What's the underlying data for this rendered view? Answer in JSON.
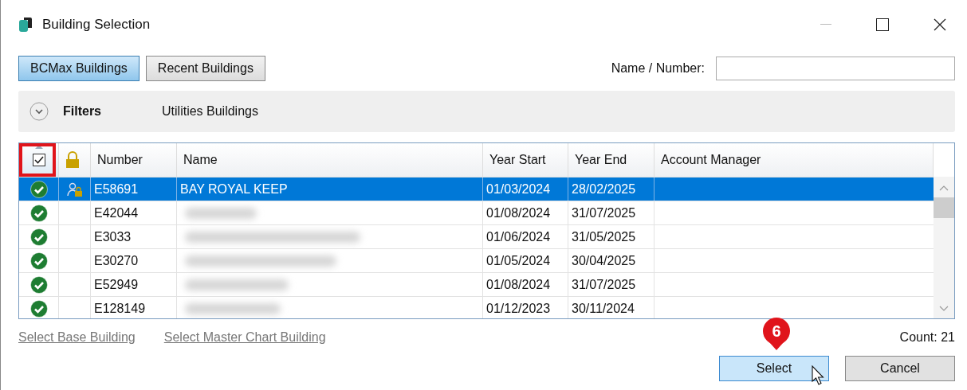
{
  "window": {
    "title": "Building Selection"
  },
  "tabs": [
    {
      "label": "BCMax Buildings",
      "selected": true
    },
    {
      "label": "Recent Buildings",
      "selected": false
    }
  ],
  "search": {
    "label": "Name / Number:"
  },
  "filters": {
    "label": "Filters",
    "expanded": false,
    "value": "Utilities Buildings"
  },
  "table": {
    "header_checkbox": {
      "checked": true,
      "highlighted": true
    },
    "columns": [
      "Number",
      "Name",
      "Year Start",
      "Year End",
      "Account Manager"
    ],
    "rows": [
      {
        "valid": true,
        "locked": true,
        "number": "E58691",
        "name": "BAY ROYAL KEEP",
        "blurred": false,
        "year_start": "01/03/2024",
        "year_end": "28/02/2025",
        "selected": true
      },
      {
        "valid": true,
        "locked": false,
        "number": "E42044",
        "blurred": true,
        "year_start": "01/08/2024",
        "year_end": "31/07/2025",
        "selected": false
      },
      {
        "valid": true,
        "locked": false,
        "number": "E3033",
        "blurred": true,
        "year_start": "01/06/2024",
        "year_end": "31/05/2025",
        "selected": false
      },
      {
        "valid": true,
        "locked": false,
        "number": "E30270",
        "blurred": true,
        "year_start": "01/05/2024",
        "year_end": "30/04/2025",
        "selected": false
      },
      {
        "valid": true,
        "locked": false,
        "number": "E52949",
        "blurred": true,
        "year_start": "01/08/2024",
        "year_end": "31/07/2025",
        "selected": false
      },
      {
        "valid": true,
        "locked": false,
        "number": "E128149",
        "blurred": true,
        "year_start": "01/12/2023",
        "year_end": "30/11/2024",
        "selected": false
      }
    ]
  },
  "links": [
    {
      "label": "Select Base Building",
      "disabled": true
    },
    {
      "label": "Select Master Chart Building",
      "disabled": true
    }
  ],
  "count": "Count: 21",
  "buttons": [
    {
      "label": "Select",
      "kind": "primary"
    },
    {
      "label": "Cancel",
      "kind": "secondary"
    }
  ],
  "callout": {
    "label": "6"
  }
}
